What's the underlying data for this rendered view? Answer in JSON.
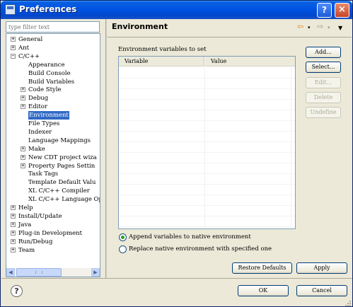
{
  "window": {
    "title": "Preferences",
    "help_button": "?",
    "close_button": "×"
  },
  "filter": {
    "placeholder": "type filter text"
  },
  "tree": {
    "items": [
      {
        "label": "General",
        "expander": "+",
        "level": 0
      },
      {
        "label": "Ant",
        "expander": "+",
        "level": 0
      },
      {
        "label": "C/C++",
        "expander": "−",
        "level": 0
      },
      {
        "label": "Appearance",
        "expander": "",
        "level": 1
      },
      {
        "label": "Build Console",
        "expander": "",
        "level": 1
      },
      {
        "label": "Build Variables",
        "expander": "",
        "level": 1
      },
      {
        "label": "Code Style",
        "expander": "+",
        "level": 1
      },
      {
        "label": "Debug",
        "expander": "+",
        "level": 1
      },
      {
        "label": "Editor",
        "expander": "+",
        "level": 1
      },
      {
        "label": "Environment",
        "expander": "",
        "level": 1,
        "selected": true
      },
      {
        "label": "File Types",
        "expander": "",
        "level": 1
      },
      {
        "label": "Indexer",
        "expander": "",
        "level": 1
      },
      {
        "label": "Language Mappings",
        "expander": "",
        "level": 1
      },
      {
        "label": "Make",
        "expander": "+",
        "level": 1
      },
      {
        "label": "New CDT project wiza",
        "expander": "+",
        "level": 1
      },
      {
        "label": "Property Pages Settin",
        "expander": "+",
        "level": 1
      },
      {
        "label": "Task Tags",
        "expander": "",
        "level": 1
      },
      {
        "label": "Template Default Valu",
        "expander": "",
        "level": 1
      },
      {
        "label": "XL C/C++ Compiler",
        "expander": "",
        "level": 1
      },
      {
        "label": "XL C/C++ Language Opt",
        "expander": "",
        "level": 1
      },
      {
        "label": "Help",
        "expander": "+",
        "level": 0
      },
      {
        "label": "Install/Update",
        "expander": "+",
        "level": 0
      },
      {
        "label": "Java",
        "expander": "+",
        "level": 0
      },
      {
        "label": "Plug-in Development",
        "expander": "+",
        "level": 0
      },
      {
        "label": "Run/Debug",
        "expander": "+",
        "level": 0
      },
      {
        "label": "Team",
        "expander": "+",
        "level": 0
      }
    ]
  },
  "page": {
    "title": "Environment",
    "nav": {
      "back_icon": "⇦",
      "forward_icon": "⇨",
      "dropdown_icon": "▾",
      "menu_icon": "▼"
    },
    "env_label": "Environment variables to set",
    "table": {
      "columns": [
        "Variable",
        "Value"
      ],
      "rows": []
    },
    "buttons": {
      "add": "Add...",
      "select": "Select...",
      "edit": "Edit...",
      "delete": "Delete",
      "undefine": "Undefine"
    },
    "radios": {
      "append": "Append variables to native environment",
      "replace": "Replace native environment with specified one",
      "selected": "append"
    },
    "restore_defaults": "Restore Defaults",
    "apply": "Apply"
  },
  "footer": {
    "help_icon": "?",
    "ok": "OK",
    "cancel": "Cancel"
  },
  "colors": {
    "title_bar": "#0054e3",
    "selection": "#316ac5",
    "dialog_bg": "#ece9d8",
    "button_border": "#003c74",
    "radio_dot": "#21a121"
  }
}
